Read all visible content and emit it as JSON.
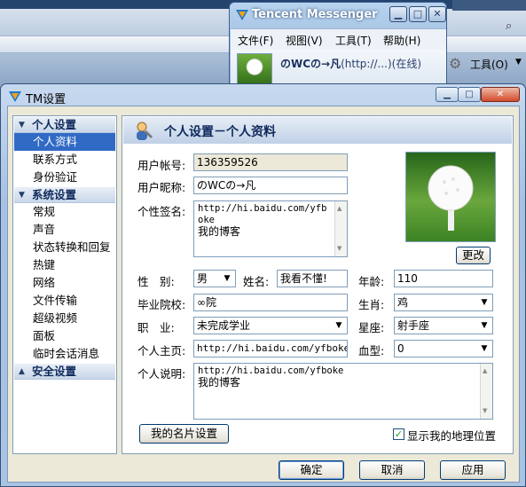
{
  "messenger": {
    "title": "Tencent Messenger",
    "menu": [
      "文件(F)",
      "视图(V)",
      "工具(T)",
      "帮助(H)"
    ],
    "nickname": "のWCの→凡",
    "status": "(http://...)(在线)",
    "tools_label": "工具(O)"
  },
  "dialog": {
    "title": "TM设置",
    "nav": {
      "groups": [
        {
          "label": "个人设置",
          "items": [
            "个人资料",
            "联系方式",
            "身份验证"
          ]
        },
        {
          "label": "系统设置",
          "items": [
            "常规",
            "声音",
            "状态转换和回复",
            "热键",
            "网络",
            "文件传输",
            "超级视频",
            "面板",
            "临时会话消息"
          ]
        },
        {
          "label": "安全设置",
          "items": []
        }
      ],
      "selected": "个人资料"
    },
    "panel_title": "个人设置－个人资料",
    "fields": {
      "account_label": "用户帐号:",
      "account": "136359526",
      "nick_label": "用户昵称:",
      "nick": "のWCの→凡",
      "signature_label": "个性签名:",
      "signature_url": "http://hi.baidu.com/yfboke",
      "signature_text": "我的博客",
      "gender_label": "性　别:",
      "gender": "男",
      "name_label": "姓名:",
      "name": "我看不懂!",
      "age_label": "年龄:",
      "age": "110",
      "school_label": "毕业院校:",
      "school": "∞院",
      "zodiac_label": "生肖:",
      "zodiac": "鸡",
      "job_label": "职　业:",
      "job": "未完成学业",
      "star_label": "星座:",
      "star": "射手座",
      "homepage_label": "个人主页:",
      "homepage": "http://hi.baidu.com/yfboke/",
      "blood_label": "血型:",
      "blood": "0",
      "desc_label": "个人说明:",
      "desc_url": "http://hi.baidu.com/yfboke",
      "desc_text": "我的博客"
    },
    "change_button": "更改",
    "card_button": "我的名片设置",
    "show_location": "显示我的地理位置",
    "ok_button": "确定",
    "cancel_button": "取消",
    "apply_button": "应用"
  }
}
